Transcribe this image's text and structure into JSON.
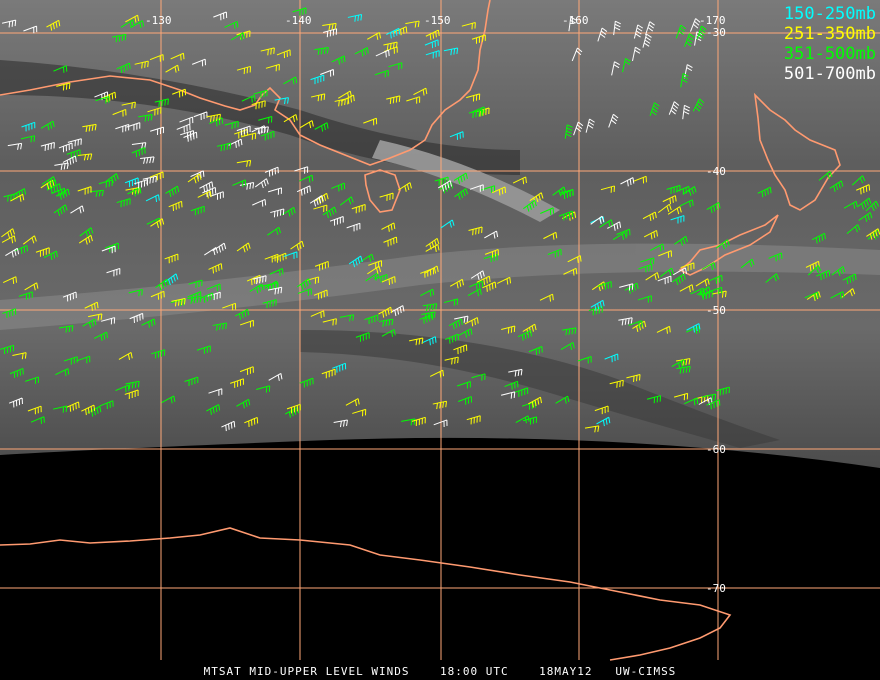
{
  "legend": [
    {
      "label": "150-250mb",
      "color": "#00ffff"
    },
    {
      "label": "251-350mb",
      "color": "#ffff00"
    },
    {
      "label": "351-500mb",
      "color": "#00ff00"
    },
    {
      "label": "501-700mb",
      "color": "#ffffff"
    }
  ],
  "longitude_labels": [
    "-130",
    "-140",
    "-150",
    "-160",
    "-170"
  ],
  "latitude_labels": [
    "-30",
    "-40",
    "-50",
    "-60",
    "-70"
  ],
  "footer": {
    "product": "MTSAT MID-UPPER LEVEL WINDS",
    "time": "18:00 UTC",
    "date": "18MAY12",
    "source": "UW-CIMSS"
  },
  "colors": {
    "coastline": "#ff9a70",
    "gridline": "#ffa878",
    "space": "#000000"
  }
}
